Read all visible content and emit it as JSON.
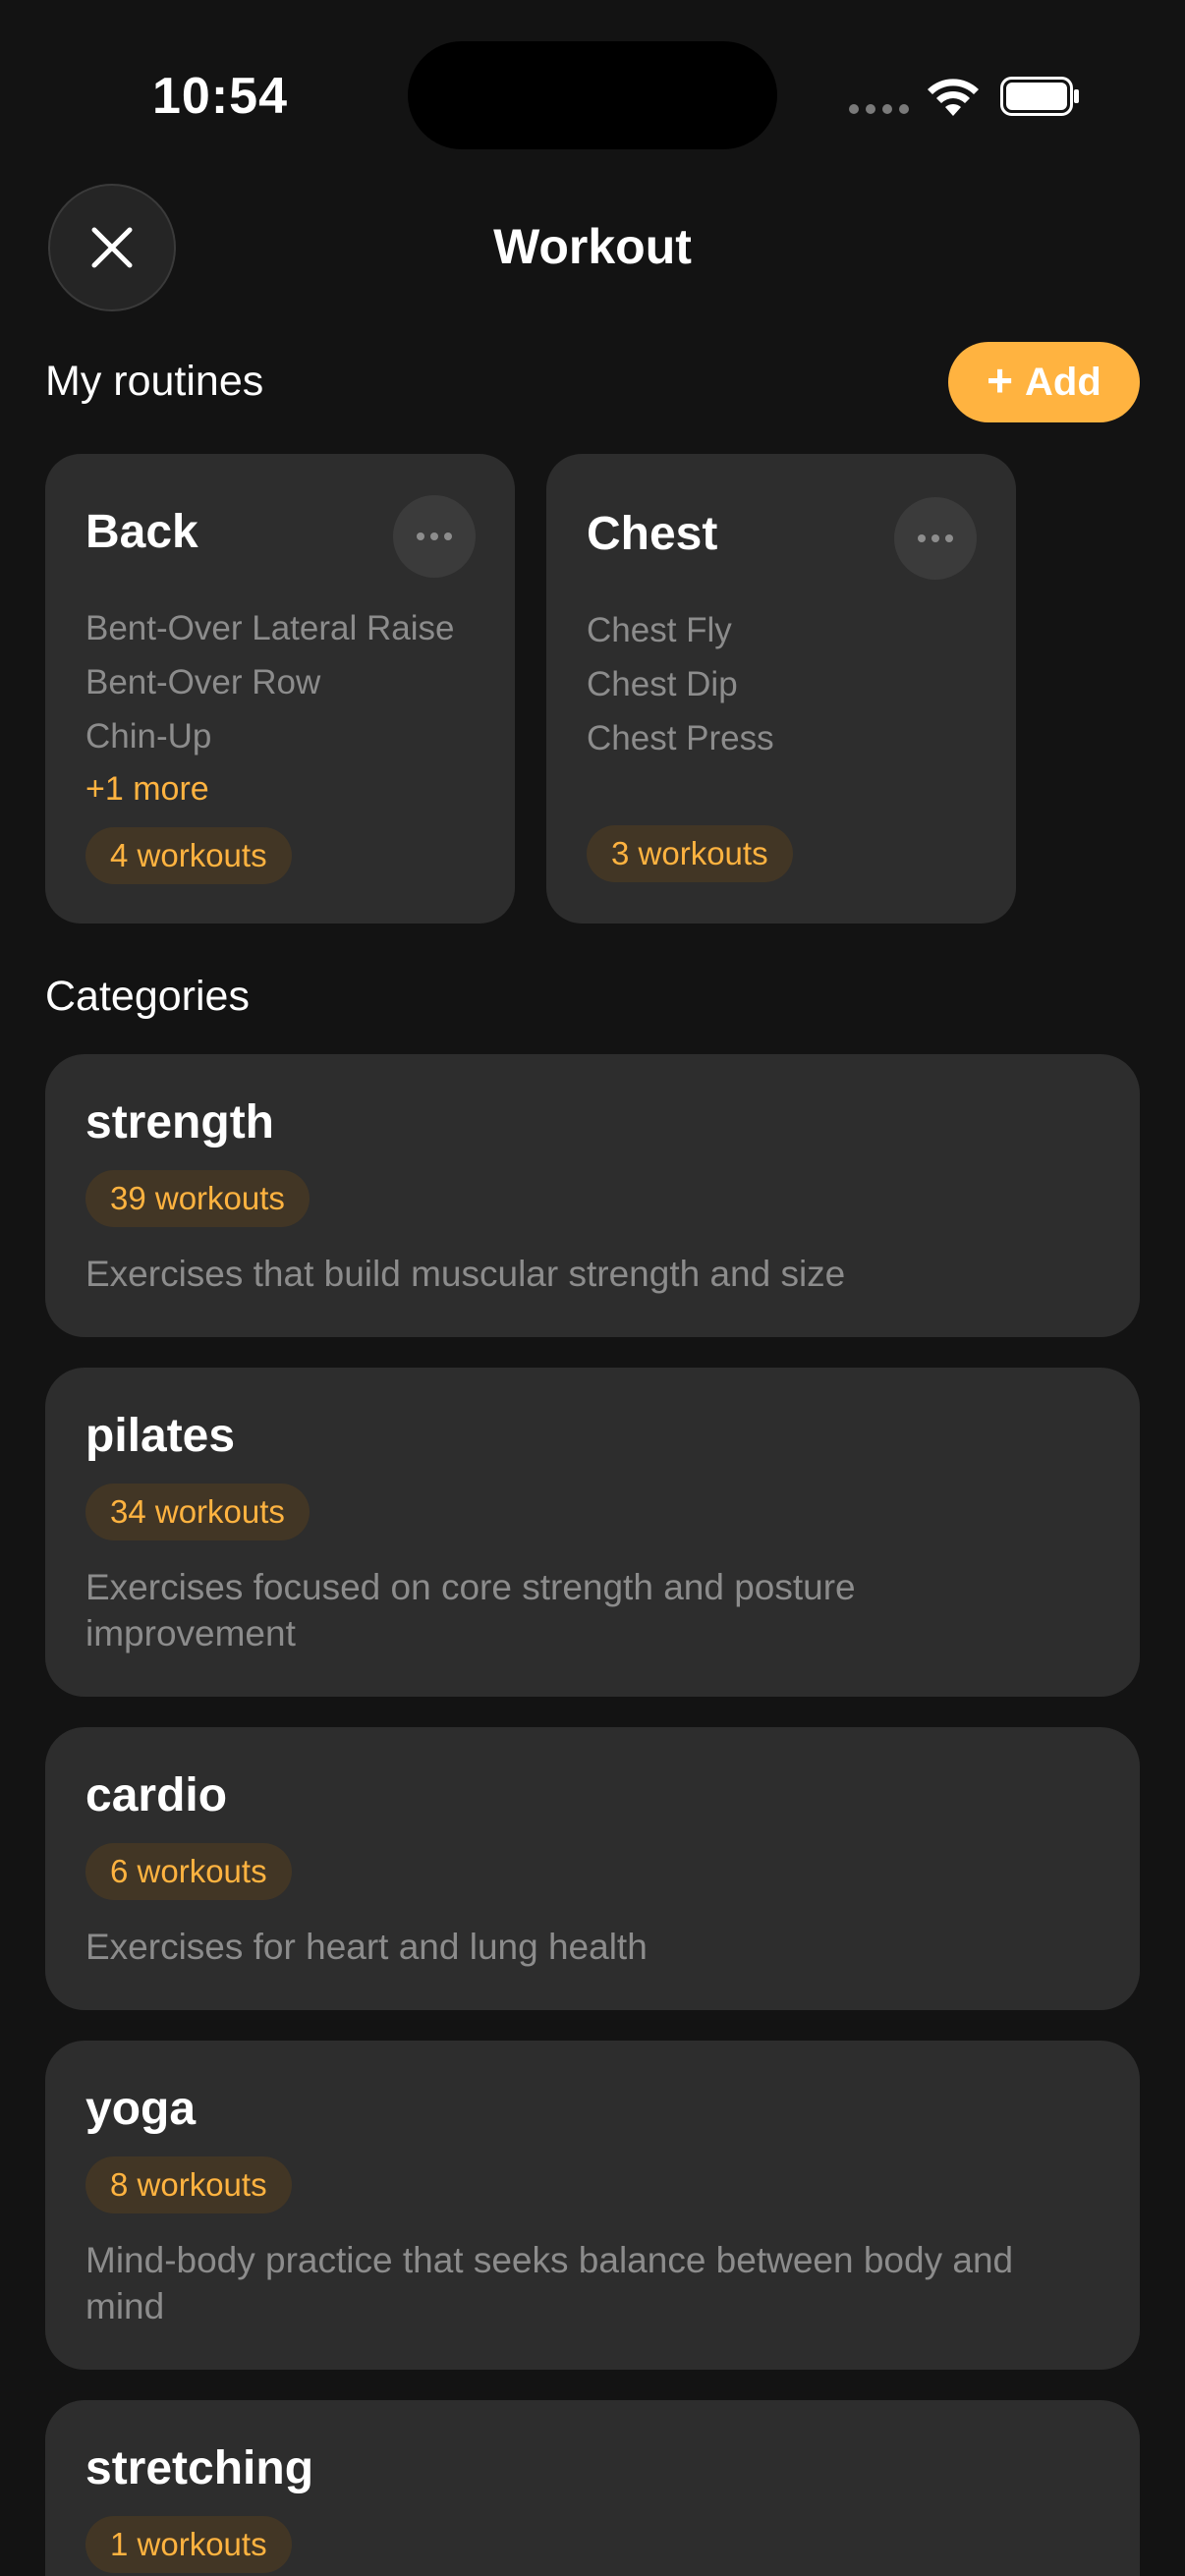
{
  "status_bar": {
    "time": "10:54"
  },
  "header": {
    "title": "Workout"
  },
  "routines_section": {
    "title": "My routines",
    "add_label": "Add"
  },
  "routines": [
    {
      "name": "Back",
      "exercises": [
        "Bent-Over Lateral Raise",
        "Bent-Over Row",
        "Chin-Up"
      ],
      "more": "+1 more",
      "count": "4 workouts"
    },
    {
      "name": "Chest",
      "exercises": [
        "Chest Fly",
        "Chest Dip",
        "Chest Press"
      ],
      "more": "",
      "count": "3 workouts"
    }
  ],
  "categories_section": {
    "title": "Categories"
  },
  "categories": [
    {
      "name": "strength",
      "count": "39 workouts",
      "description": "Exercises that build muscular strength and size"
    },
    {
      "name": "pilates",
      "count": "34 workouts",
      "description": "Exercises focused on core strength and posture improvement"
    },
    {
      "name": "cardio",
      "count": "6 workouts",
      "description": "Exercises for heart and lung health"
    },
    {
      "name": "yoga",
      "count": "8 workouts",
      "description": "Mind-body practice that seeks balance between body and mind"
    },
    {
      "name": "stretching",
      "count": "1 workouts",
      "description": ""
    }
  ],
  "colors": {
    "background": "#131313",
    "card": "#2d2d2d",
    "accent": "#FFB340",
    "badge_bg": "#423625",
    "muted_text": "#8c8c8c"
  },
  "icons": {
    "close": "close-icon",
    "more": "more-icon",
    "plus": "plus-icon",
    "wifi": "wifi-icon",
    "battery": "battery-icon"
  }
}
